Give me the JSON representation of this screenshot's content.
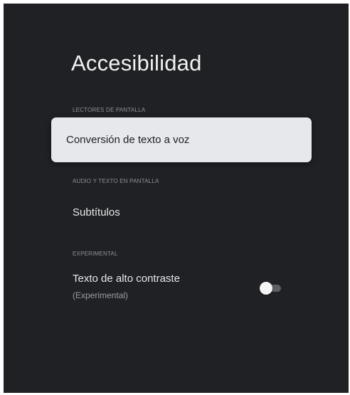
{
  "page": {
    "title": "Accesibilidad"
  },
  "sections": [
    {
      "header": "LECTORES DE PANTALLA",
      "items": [
        {
          "label": "Conversión de texto a voz",
          "focused": true
        }
      ]
    },
    {
      "header": "AUDIO Y TEXTO EN PANTALLA",
      "items": [
        {
          "label": "Subtítulos"
        }
      ]
    },
    {
      "header": "EXPERIMENTAL",
      "items": [
        {
          "label": "Texto de alto contraste",
          "sublabel": "(Experimental)",
          "toggle": "off"
        }
      ]
    }
  ],
  "colors": {
    "background": "#202125",
    "focus_card": "#e6e8ec",
    "primary_text": "#e9e9ea",
    "secondary_text": "#8f9198"
  }
}
